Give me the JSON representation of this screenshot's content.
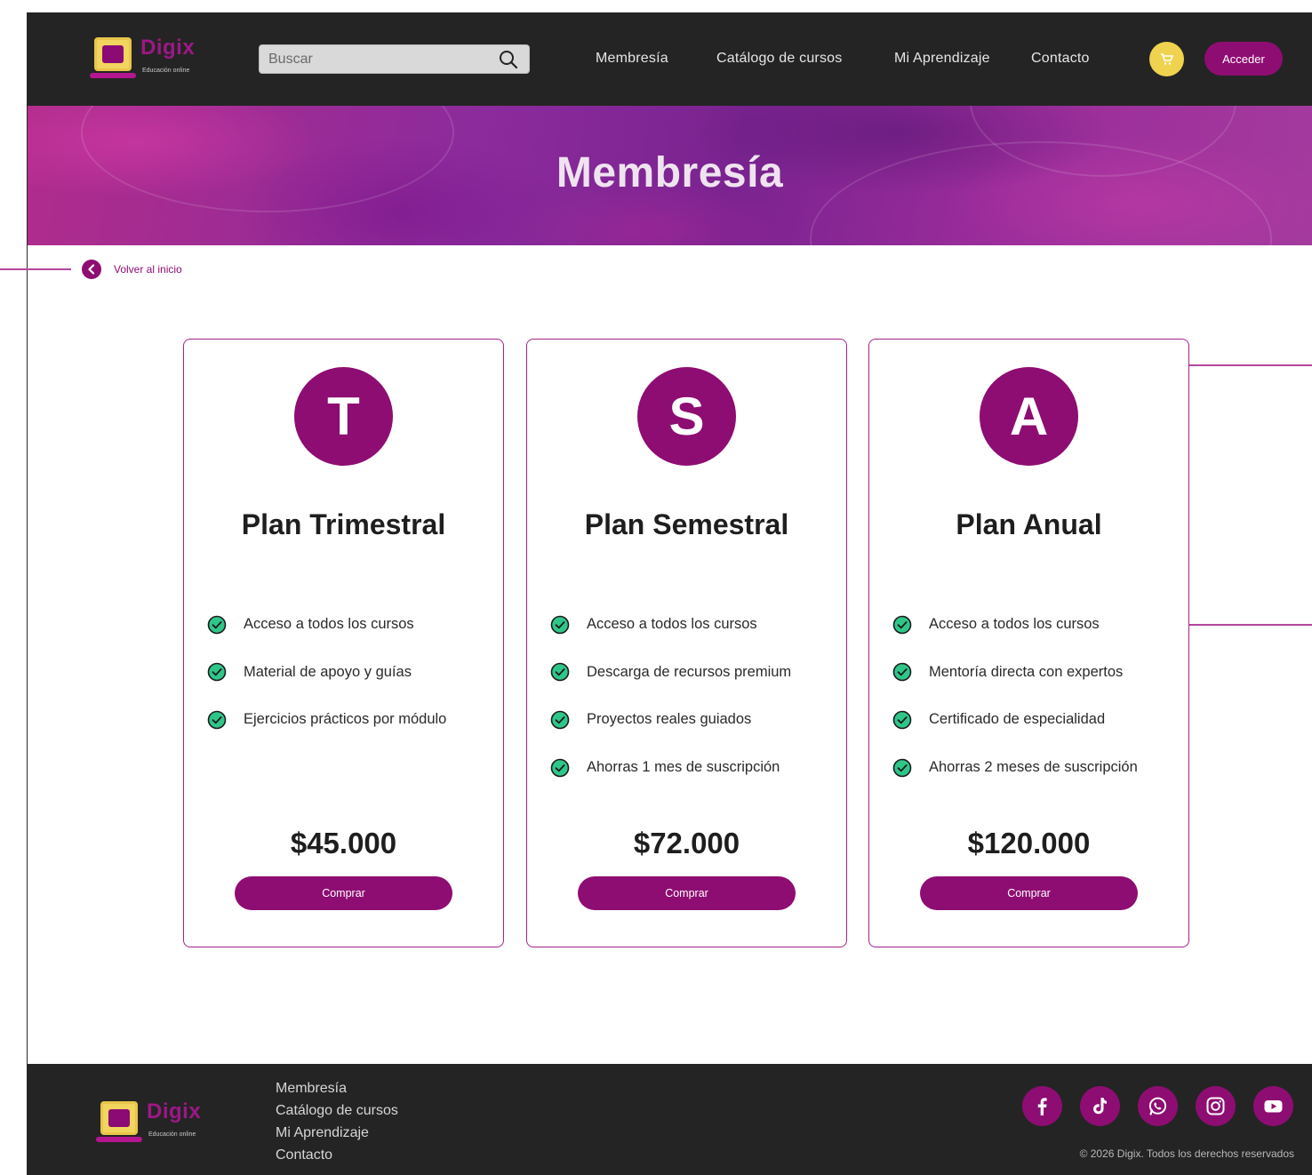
{
  "header": {
    "logo_word": "Digix",
    "logo_tagline": "Educación online",
    "search_placeholder": "Buscar",
    "nav": [
      "Membresía",
      "Catálogo de cursos",
      "Mi Aprendizaje",
      "Contacto"
    ],
    "login_label": "Acceder"
  },
  "hero": {
    "title": "Membresía"
  },
  "back_link": "Volver al inicio",
  "plans": [
    {
      "badge": "T",
      "title": "Plan Trimestral",
      "features": [
        "Acceso a todos los cursos",
        "Material de apoyo y guías",
        "Ejercicios prácticos por módulo"
      ],
      "price": "$45.000",
      "button": "Comprar"
    },
    {
      "badge": "S",
      "title": "Plan Semestral",
      "features": [
        "Acceso a todos los cursos",
        "Descarga de recursos premium",
        "Proyectos reales guiados",
        "Ahorras 1 mes de suscripción"
      ],
      "price": "$72.000",
      "button": "Comprar"
    },
    {
      "badge": "A",
      "title": "Plan Anual",
      "features": [
        "Acceso a todos los cursos",
        "Mentoría directa con expertos",
        "Certificado de especialidad",
        "Ahorras 2 meses de suscripción"
      ],
      "price": "$120.000",
      "button": "Comprar"
    }
  ],
  "footer": {
    "logo_word": "Digix",
    "logo_tagline": "Educación online",
    "links": [
      "Membresía",
      "Catálogo de cursos",
      "Mi Aprendizaje",
      "Contacto"
    ],
    "socials": [
      "facebook-icon",
      "tiktok-icon",
      "whatsapp-icon",
      "instagram-icon",
      "youtube-icon"
    ],
    "copyright": "© 2026 Digix. Todos los derechos reservados"
  },
  "colors": {
    "brand": "#8e0d72",
    "accent_yellow": "#efd34f",
    "dark_bg": "#242424",
    "check_green": "#2fc68a"
  }
}
